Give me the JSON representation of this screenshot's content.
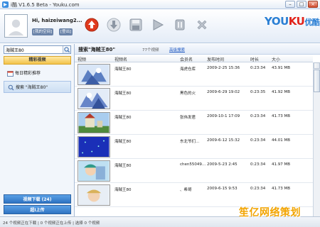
{
  "window": {
    "title": "i酷 V1.6.5 Beta - Youku.com",
    "controls": [
      "–",
      "□",
      "×"
    ]
  },
  "header": {
    "username": "Hi, haizeiwang2...",
    "my_space_label": "[我的空间]",
    "logout_label": "[登出]",
    "toolbar_icons": [
      "play-circle-icon",
      "download-icon",
      "save-icon",
      "play-icon",
      "pause-icon",
      "delete-icon"
    ],
    "logo_text_blue": "YOU",
    "logo_text_red": "KU",
    "logo_text_cn": "优酷"
  },
  "sidebar": {
    "search_value": "海贼王80",
    "featured_label": "精彩视频",
    "items": [
      {
        "label": "每日精彩推荐",
        "icon": "calendar-icon"
      },
      {
        "label": "搜索 \"海贼王80\"",
        "icon": "search-icon"
      }
    ],
    "download_tab": "视频下载 (24)",
    "upload_tab": "超I上传"
  },
  "results": {
    "title": "搜索\"海贼王80\"",
    "count": "77个视频",
    "advanced_link": "高级搜索",
    "columns": {
      "video": "视频",
      "name": "视频名",
      "member": "会员名",
      "time": "发布时间",
      "duration": "时长",
      "size": "大小"
    },
    "rows": [
      {
        "name": "海贼王80",
        "member": "海虎仓库",
        "time": "2009-2-25 15:36",
        "duration": "0:23:34",
        "size": "43.91 MB",
        "thumb": "anime"
      },
      {
        "name": "海贼王80",
        "member": "黑色的火",
        "time": "2009-6-29 19:02",
        "duration": "0:23:35",
        "size": "41.92 MB",
        "thumb": "anime"
      },
      {
        "name": "海贼王80",
        "member": "张伟发君",
        "time": "2009-10-1 17:09",
        "duration": "0:23:34",
        "size": "41.73 MB",
        "thumb": "castle"
      },
      {
        "name": "海贼王80",
        "member": "东北爷们...",
        "time": "2009-6-12 15:32",
        "duration": "0:23:34",
        "size": "44.01 MB",
        "thumb": "blue"
      },
      {
        "name": "海贼王80",
        "member": "chen55049...",
        "time": "2009-5-23 2:45",
        "duration": "0:23:34",
        "size": "41.97 MB",
        "thumb": "anime"
      },
      {
        "name": "海贼王80",
        "member": "、希哥",
        "time": "2009-6-15 9:53",
        "duration": "0:23:34",
        "size": "41.73 MB",
        "thumb": "anime"
      }
    ]
  },
  "status": {
    "text": "24 个视频正在下载 | 0 个视频正在上传 | 选择 0 个视频"
  },
  "watermark": "笙亿网络策划",
  "colors": {
    "accent_blue": "#2e73c2",
    "logo_blue": "#2a7fd4",
    "logo_red": "#e2231a",
    "highlight_yellow": "#f2c34a"
  }
}
